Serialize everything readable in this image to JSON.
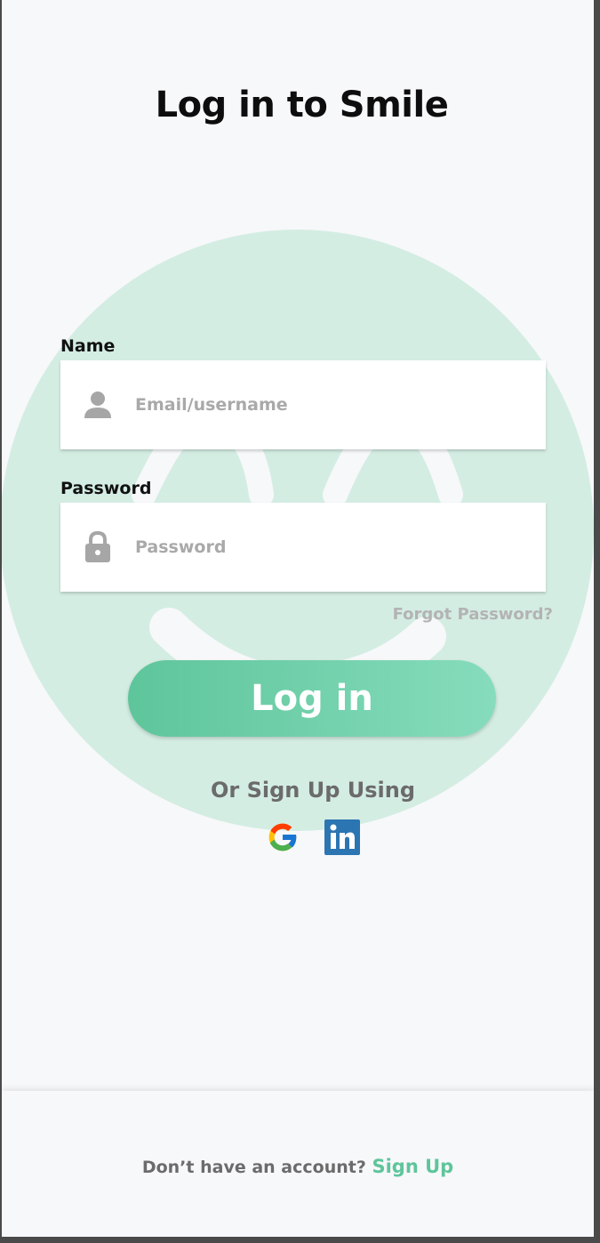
{
  "title": "Log in to Smile",
  "form": {
    "name_label": "Name",
    "name_placeholder": "Email/username",
    "password_label": "Password",
    "password_placeholder": "Password",
    "forgot_password": "Forgot Password?",
    "login_button": "Log in"
  },
  "social": {
    "heading": "Or Sign Up Using",
    "providers": [
      {
        "name": "Google",
        "icon": "google-icon"
      },
      {
        "name": "LinkedIn",
        "icon": "linkedin-icon"
      }
    ]
  },
  "footer": {
    "prompt": "Don’t have an account? ",
    "signup_link": "Sign Up"
  },
  "colors": {
    "accent": "#5ec59b",
    "background": "#f7f8fa",
    "smiley": "#d4ede3",
    "linkedin": "#2c75b3"
  },
  "icons": {
    "user": "user-icon",
    "lock": "lock-icon"
  }
}
